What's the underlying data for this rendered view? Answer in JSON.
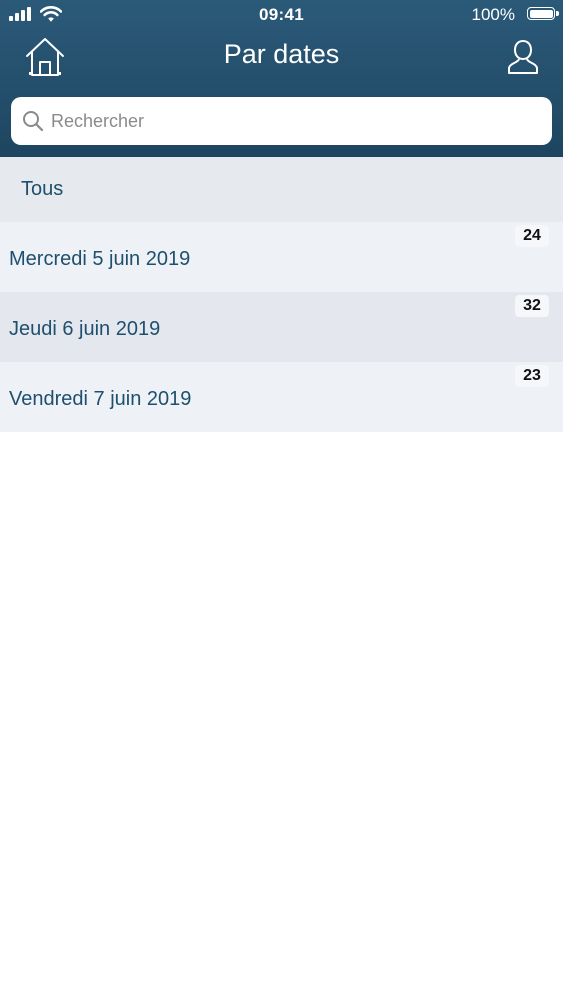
{
  "status_bar": {
    "time": "09:41",
    "battery": "100%"
  },
  "nav": {
    "title": "Par dates",
    "home_icon": "home-icon",
    "profile_icon": "user-icon"
  },
  "search": {
    "placeholder": "Rechercher",
    "value": ""
  },
  "list": {
    "all_label": "Tous",
    "dates": [
      {
        "label": "Mercredi 5 juin 2019",
        "count": "24"
      },
      {
        "label": "Jeudi 6 juin 2019",
        "count": "32"
      },
      {
        "label": "Vendredi 7 juin 2019",
        "count": "23"
      }
    ]
  },
  "colors": {
    "header": "#244f6c",
    "accent_text": "#1f4f6e",
    "row_light": "#eef1f5",
    "row_dark": "#e4e8ee"
  }
}
